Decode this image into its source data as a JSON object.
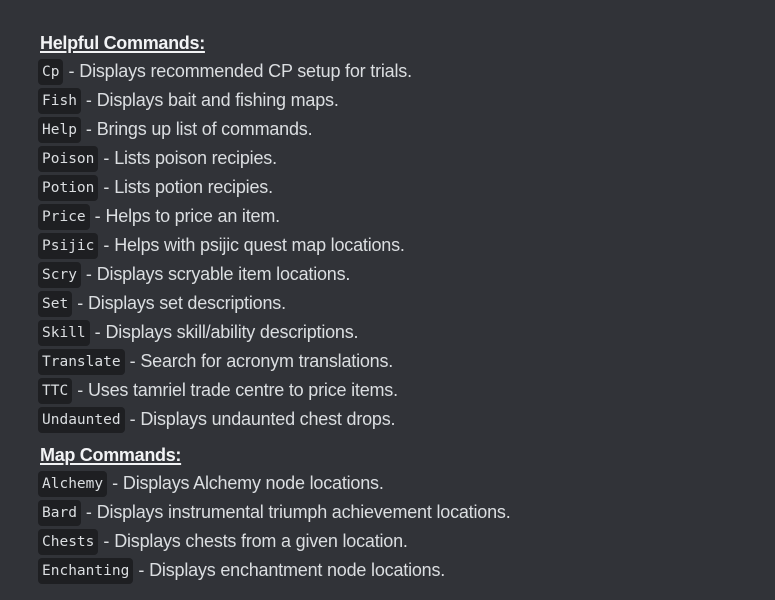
{
  "sections": [
    {
      "heading": "Helpful Commands:",
      "commands": [
        {
          "name": "Cp",
          "description": "Displays recommended CP setup for trials."
        },
        {
          "name": "Fish",
          "description": "Displays bait and fishing maps."
        },
        {
          "name": "Help",
          "description": "Brings up list of commands."
        },
        {
          "name": "Poison",
          "description": "Lists poison recipies."
        },
        {
          "name": "Potion",
          "description": "Lists potion recipies."
        },
        {
          "name": "Price",
          "description": "Helps to price an item."
        },
        {
          "name": "Psijic",
          "description": "Helps with psijic quest map locations."
        },
        {
          "name": "Scry",
          "description": "Displays scryable item locations."
        },
        {
          "name": "Set",
          "description": "Displays set descriptions."
        },
        {
          "name": "Skill",
          "description": "Displays skill/ability descriptions."
        },
        {
          "name": "Translate",
          "description": "Search for acronym translations."
        },
        {
          "name": "TTC",
          "description": "Uses tamriel trade centre to price items."
        },
        {
          "name": "Undaunted",
          "description": "Displays undaunted chest drops."
        }
      ]
    },
    {
      "heading": "Map Commands:",
      "commands": [
        {
          "name": "Alchemy",
          "description": "Displays Alchemy node locations."
        },
        {
          "name": "Bard",
          "description": "Displays instrumental triumph achievement locations."
        },
        {
          "name": "Chests",
          "description": "Displays chests from a given location."
        },
        {
          "name": "Enchanting",
          "description": "Displays enchantment node locations."
        }
      ]
    }
  ],
  "separator": "-",
  "colors": {
    "background": "#313338",
    "code_background": "#1e1f22",
    "text": "#dbdee1",
    "heading": "#f2f3f5"
  }
}
